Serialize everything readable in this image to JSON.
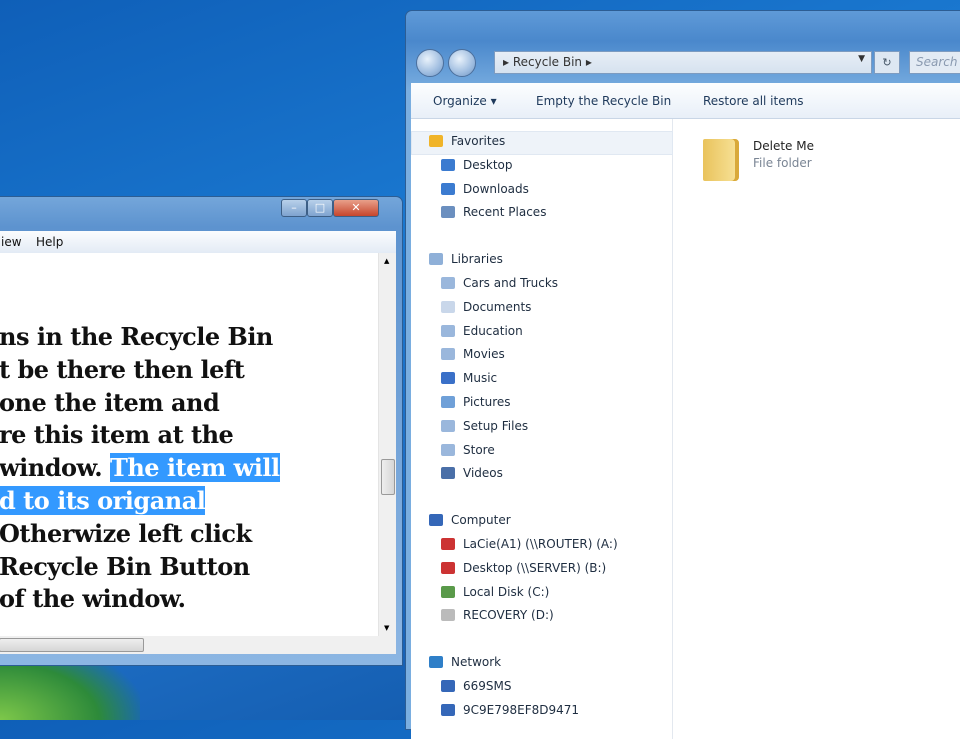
{
  "explorer": {
    "address": {
      "path": "Recycle Bin",
      "search_placeholder": "Search"
    },
    "toolbar": {
      "organize": "Organize ▾",
      "empty": "Empty the Recycle Bin",
      "restore": "Restore all items"
    },
    "nav": [
      {
        "label": "Favorites",
        "icon": "star-icon",
        "group": true
      },
      {
        "label": "Desktop",
        "icon": "desktop-icon"
      },
      {
        "label": "Downloads",
        "icon": "downloads-icon"
      },
      {
        "label": "Recent Places",
        "icon": "recent-places-icon"
      },
      {
        "label": "Libraries",
        "icon": "libraries-icon",
        "group": true
      },
      {
        "label": "Cars and Trucks",
        "icon": "library-icon"
      },
      {
        "label": "Documents",
        "icon": "documents-icon"
      },
      {
        "label": "Education",
        "icon": "library-icon"
      },
      {
        "label": "Movies",
        "icon": "library-icon"
      },
      {
        "label": "Music",
        "icon": "music-icon"
      },
      {
        "label": "Pictures",
        "icon": "pictures-icon"
      },
      {
        "label": "Setup Files",
        "icon": "library-icon"
      },
      {
        "label": "Store",
        "icon": "library-icon"
      },
      {
        "label": "Videos",
        "icon": "videos-icon"
      },
      {
        "label": "Computer",
        "icon": "computer-icon",
        "group": true
      },
      {
        "label": "LaCie(A1) (\\\\ROUTER) (A:)",
        "icon": "network-drive-disconnected-icon"
      },
      {
        "label": "Desktop (\\\\SERVER) (B:)",
        "icon": "network-drive-disconnected-icon"
      },
      {
        "label": "Local Disk (C:)",
        "icon": "local-disk-icon"
      },
      {
        "label": "RECOVERY (D:)",
        "icon": "drive-icon"
      },
      {
        "label": "Network",
        "icon": "network-icon",
        "group": true
      },
      {
        "label": "669SMS",
        "icon": "computer-icon"
      },
      {
        "label": "9C9E798EF8D9471",
        "icon": "computer-icon"
      }
    ],
    "files": [
      {
        "name": "Delete Me",
        "type": "File folder"
      }
    ]
  },
  "notepad": {
    "menu": {
      "view": "iew",
      "help": "Help"
    },
    "lines": [
      {
        "text": "ns in the Recycle Bin"
      },
      {
        "text": "t be there then left"
      },
      {
        "text": " one the item and"
      },
      {
        "text": "re this item at the"
      },
      {
        "text": "window. ",
        "selected": "The item will"
      },
      {
        "text": "",
        "selected": "d to its origanal"
      },
      {
        "text": "Otherwize left click"
      },
      {
        "text": " Recycle Bin Button"
      },
      {
        "text": "of the window."
      }
    ]
  },
  "colors": {
    "selection": "#3399ff",
    "desktop": "#1a78d0"
  }
}
